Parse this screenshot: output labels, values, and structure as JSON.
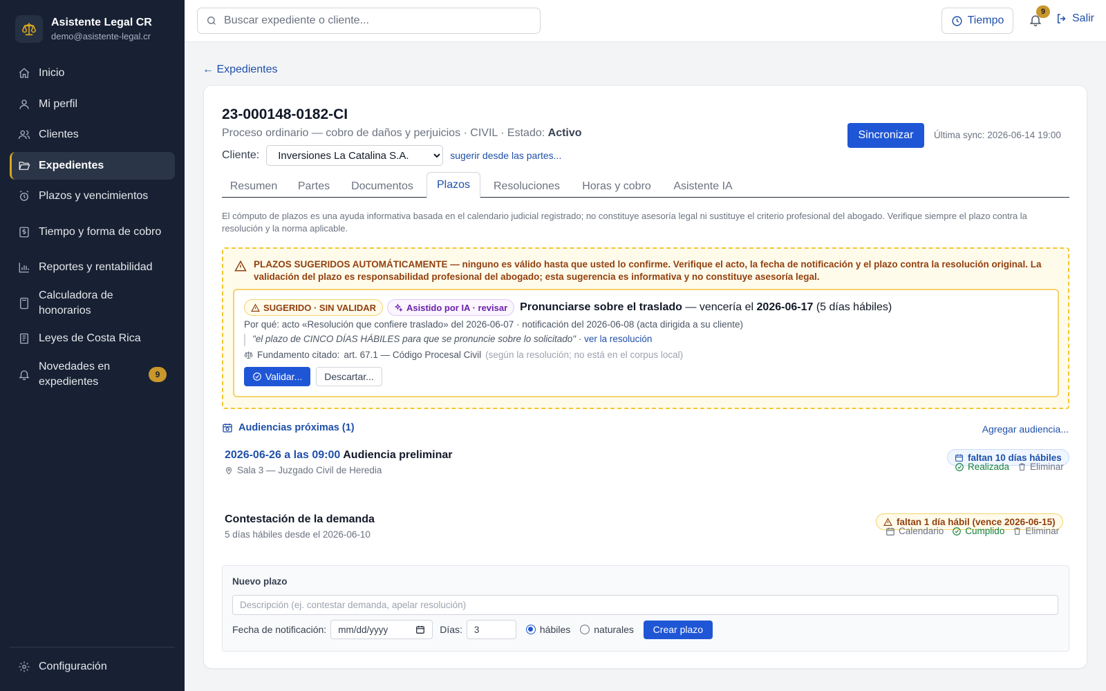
{
  "brand": {
    "title": "Asistente Legal CR",
    "email": "demo@asistente-legal.cr"
  },
  "sidebar": {
    "items": [
      {
        "label": "Inicio",
        "icon": "home-icon"
      },
      {
        "label": "Mi perfil",
        "icon": "user-icon"
      },
      {
        "label": "Clientes",
        "icon": "users-icon"
      },
      {
        "label": "Expedientes",
        "icon": "folder-icon",
        "active": true
      },
      {
        "label": "Plazos y vencimientos",
        "icon": "alarm-clock-icon"
      },
      {
        "label": "Tiempo y forma de cobro",
        "icon": "billing-icon"
      },
      {
        "label": "Reportes y rentabilidad",
        "icon": "bar-chart-icon"
      },
      {
        "label": "Calculadora de honorarios",
        "icon": "calculator-icon"
      },
      {
        "label": "Leyes de Costa Rica",
        "icon": "book-icon"
      },
      {
        "label": "Novedades en expedientes",
        "icon": "bell-icon",
        "badge": "9"
      }
    ],
    "settings_label": "Configuración"
  },
  "header": {
    "search_placeholder": "Buscar expediente o cliente...",
    "tiempo_label": "Tiempo",
    "notification_count": "9",
    "logout_label": "Salir"
  },
  "main": {
    "back_label": "← Expedientes",
    "case": {
      "number": "23-000148-0182-CI",
      "subtitle_prefix": "Proceso ordinario — cobro de daños y perjuicios · CIVIL · Estado: ",
      "status": "Activo",
      "client_label": "Cliente:",
      "client_value": "Inversiones La Catalina S.A.",
      "suggest_label": "sugerir desde las partes...",
      "sync_label": "Sincronizar",
      "last_sync": "Última sync: 2026-06-14 19:00"
    },
    "tabs": [
      "Resumen",
      "Partes",
      "Documentos",
      "Plazos",
      "Resoluciones",
      "Horas y cobro",
      "Asistente IA"
    ],
    "active_tab": "Plazos",
    "disclaimer": "El cómputo de plazos es una ayuda informativa basada en el calendario judicial registrado; no constituye asesoría legal ni sustituye el criterio profesional del abogado. Verifique siempre el plazo contra la resolución y la norma aplicable.",
    "warning": {
      "heading_strong": "PLAZOS SUGERIDOS AUTOMÁTICAMENTE",
      "heading_rest": " — ninguno es válido hasta que usted lo confirme. Verifique el acto, la fecha de notificación y el plazo contra la resolución original. La validación del plazo es responsabilidad profesional del abogado; esta sugerencia es informativa y no constituye asesoría legal."
    },
    "suggestion": {
      "badge_status": "SUGERIDO · SIN VALIDAR",
      "badge_ai": "Asistido por IA · revisar",
      "title_action": "Pronunciarse sobre el traslado",
      "title_mid": " — vencería el ",
      "due_date": "2026-06-17",
      "title_tail": " (5 días hábiles)",
      "why": "Por qué: acto «Resolución que confiere traslado» del 2026-06-07 · notificación del 2026-06-08 (acta dirigida a su cliente)",
      "quote": "\"el plazo de CINCO DÍAS HÁBILES para que se pronuncie sobre lo solicitado\"",
      "quote_sep": " · ",
      "quote_link": "ver la resolución",
      "foundation_label": "Fundamento citado:",
      "foundation_value": "art. 67.1 — Código Procesal Civil",
      "foundation_note": "(según la resolución; no está en el corpus local)",
      "validate_label": "Validar...",
      "discard_label": "Descartar..."
    },
    "hearings": {
      "heading": "Audiencias próximas (1)",
      "add_label": "Agregar audiencia...",
      "items": [
        {
          "datetime": "2026-06-26 a las 09:00",
          "name": "Audiencia preliminar",
          "location": "Sala 3 — Juzgado Civil de Heredia",
          "countdown": "faltan 10 días hábiles",
          "done_label": "Realizada",
          "delete_label": "Eliminar"
        }
      ]
    },
    "deadlines": [
      {
        "title": "Contestación de la demanda",
        "subtitle": "5 días hábiles desde el 2026-06-10",
        "countdown": "faltan 1 día hábil (vence 2026-06-15)",
        "calendar_label": "Calendario",
        "done_label": "Cumplido",
        "delete_label": "Eliminar"
      }
    ],
    "new_deadline": {
      "heading": "Nuevo plazo",
      "desc_placeholder": "Descripción (ej. contestar demanda, apelar resolución)",
      "date_label": "Fecha de notificación:",
      "date_placeholder": "mm/dd/yyyy",
      "days_label": "Días:",
      "days_value": "3",
      "option_business": "hábiles",
      "option_calendar": "naturales",
      "selected_option": "hábiles",
      "create_label": "Crear plazo"
    }
  },
  "colors": {
    "sidebar_bg": "#172133",
    "accent_blue": "#1f56d6",
    "link_blue": "#1e4fa8",
    "warning_amber": "#f4c630",
    "badge_gold": "#c9972b",
    "success_green": "#15803d"
  }
}
